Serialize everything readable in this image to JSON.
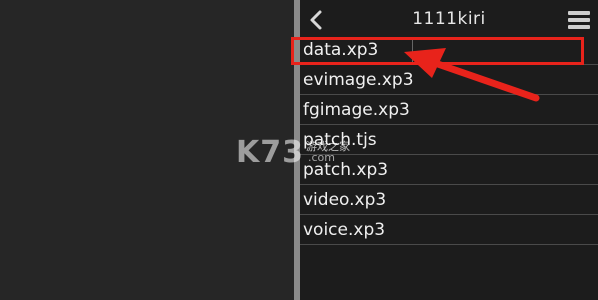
{
  "header": {
    "title": "1111kiri"
  },
  "files": [
    {
      "name": "data.xp3"
    },
    {
      "name": "evimage.xp3"
    },
    {
      "name": "fgimage.xp3"
    },
    {
      "name": "patch.tjs"
    },
    {
      "name": "patch.xp3"
    },
    {
      "name": "video.xp3"
    },
    {
      "name": "voice.xp3"
    }
  ],
  "watermark": {
    "logo": "K73",
    "site_cn": "游戏之家",
    "domain": ".com"
  },
  "colors": {
    "highlight": "#e8231b",
    "list_background": "#1c1c1c",
    "text": "#f0f0f0"
  },
  "icons": {
    "back": "chevron-left-icon",
    "menu": "hamburger-menu-icon"
  }
}
